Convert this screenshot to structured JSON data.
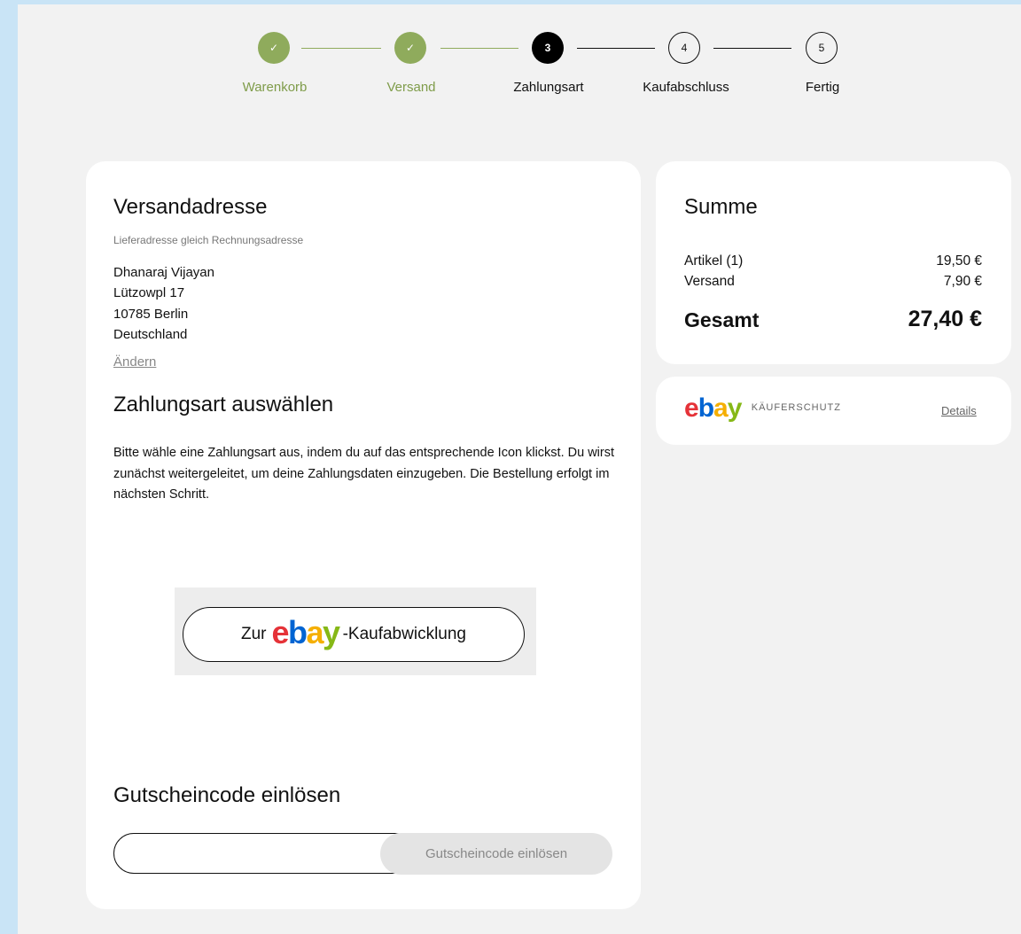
{
  "steps": [
    {
      "label": "Warenkorb",
      "state": "done",
      "marker": "✓"
    },
    {
      "label": "Versand",
      "state": "done",
      "marker": "✓"
    },
    {
      "label": "Zahlungsart",
      "state": "active",
      "marker": "3"
    },
    {
      "label": "Kaufabschluss",
      "state": "todo",
      "marker": "4"
    },
    {
      "label": "Fertig",
      "state": "todo",
      "marker": "5"
    }
  ],
  "shipping": {
    "title": "Versandadresse",
    "subtitle": "Lieferadresse gleich Rechnungsadresse",
    "name": "Dhanaraj Vijayan",
    "street": "Lützowpl 17",
    "city": "10785 Berlin",
    "country": "Deutschland",
    "change_link": "Ändern"
  },
  "payment": {
    "title": "Zahlungsart auswählen",
    "description": "Bitte wähle eine Zahlungsart aus, indem du auf das entsprechende Icon klickst. Du wirst zunächst weitergeleitet, um deine Zahlungsdaten einzugeben. Die Bestellung erfolgt im nächsten Schritt.",
    "button_prefix": "Zur",
    "button_suffix": "-Kaufabwicklung"
  },
  "ebay_logo": {
    "e": "e",
    "b": "b",
    "a": "a",
    "y": "y"
  },
  "coupon": {
    "title": "Gutscheincode einlösen",
    "input_value": "",
    "button_label": "Gutscheincode einlösen"
  },
  "summary": {
    "title": "Summe",
    "items_label": "Artikel (1)",
    "items_value": "19,50 €",
    "shipping_label": "Versand",
    "shipping_value": "7,90 €",
    "total_label": "Gesamt",
    "total_value": "27,40 €"
  },
  "protection": {
    "label": "KÄUFERSCHUTZ",
    "details_link": "Details"
  },
  "colors": {
    "step_done": "#8fab5c",
    "ebay_red": "#e53238",
    "ebay_blue": "#0064d2",
    "ebay_yellow": "#f5af02",
    "ebay_green": "#86b817"
  }
}
